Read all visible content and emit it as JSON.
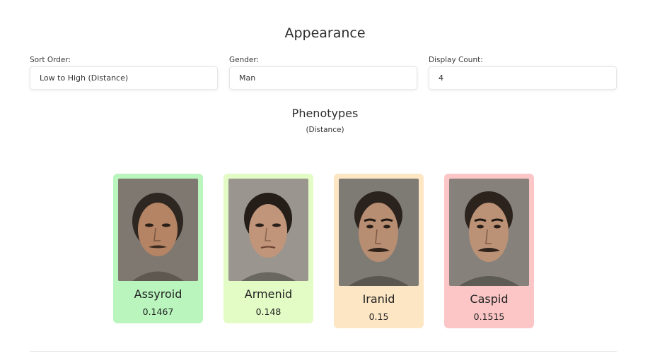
{
  "page": {
    "title": "Appearance"
  },
  "filters": {
    "sort": {
      "label": "Sort Order:",
      "value": "Low to High (Distance)"
    },
    "gender": {
      "label": "Gender:",
      "value": "Man"
    },
    "count": {
      "label": "Display Count:",
      "value": "4"
    }
  },
  "results": {
    "title": "Phenotypes",
    "caption": "(Distance)",
    "cards": [
      {
        "name": "Assyroid",
        "value": "0.1467",
        "color": "#b9f5bd"
      },
      {
        "name": "Armenid",
        "value": "0.148",
        "color": "#e3fbc5"
      },
      {
        "name": "Iranid",
        "value": "0.15",
        "color": "#fde6c4"
      },
      {
        "name": "Caspid",
        "value": "0.1515",
        "color": "#fcc6c6"
      }
    ]
  }
}
